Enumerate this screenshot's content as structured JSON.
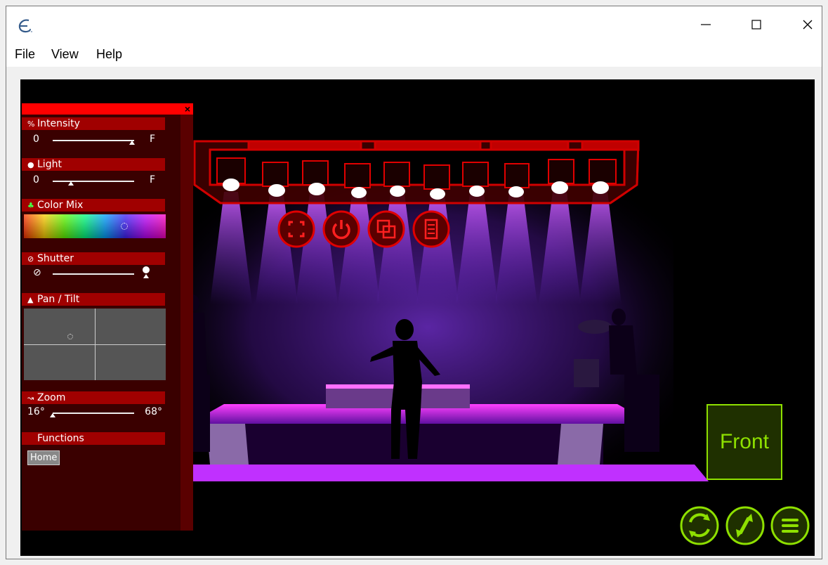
{
  "window": {
    "title": ""
  },
  "menu": {
    "file": "File",
    "view": "View",
    "help": "Help"
  },
  "panel": {
    "intensity": {
      "label": "Intensity",
      "min": "0",
      "max": "F",
      "value": 0.95
    },
    "light": {
      "label": "Light",
      "min": "0",
      "max": "F",
      "value": 0.2
    },
    "color_mix": {
      "label": "Color Mix"
    },
    "shutter": {
      "label": "Shutter",
      "min": "⊘"
    },
    "pan_tilt": {
      "label": "Pan / Tilt"
    },
    "zoom": {
      "label": "Zoom",
      "min": "16°",
      "max": "68°",
      "value": 0.0
    },
    "functions": {
      "label": "Functions",
      "home": "Home"
    }
  },
  "view_label": "Front",
  "colors": {
    "panel_red": "#ff0000",
    "panel_header": "#a00000",
    "green_accent": "#8ee000",
    "stage_purple": "#b030ff"
  },
  "icons": [
    "fullscreen-icon",
    "power-icon",
    "switch-icon",
    "list-icon",
    "rotate-view-icon",
    "swap-view-icon",
    "menu-icon"
  ]
}
